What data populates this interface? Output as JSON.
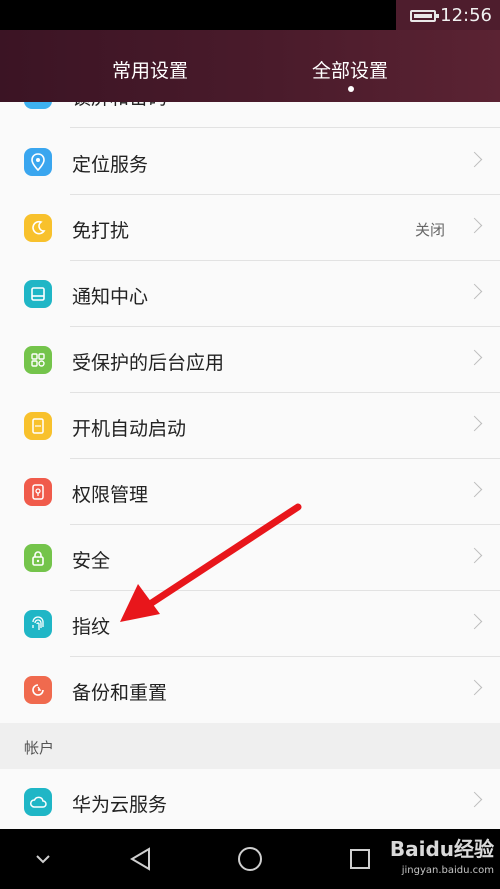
{
  "status_bar": {
    "time": "12:56"
  },
  "tabs": [
    {
      "label": "常用设置"
    },
    {
      "label": "全部设置"
    }
  ],
  "list": {
    "items": [
      {
        "label": "锁屏和密码",
        "icon": "lock-screen-icon",
        "color": "#3db1f0"
      },
      {
        "label": "定位服务",
        "icon": "location-pin-icon",
        "color": "#3aa6ef"
      },
      {
        "label": "免打扰",
        "icon": "moon-icon",
        "color": "#f8c12c",
        "value": "关闭"
      },
      {
        "label": "通知中心",
        "icon": "notification-center-icon",
        "color": "#1fb6c6"
      },
      {
        "label": "受保护的后台应用",
        "icon": "protected-apps-icon",
        "color": "#74c44b"
      },
      {
        "label": "开机自动启动",
        "icon": "auto-start-icon",
        "color": "#f8c12c"
      },
      {
        "label": "权限管理",
        "icon": "permission-manager-icon",
        "color": "#f05b4b"
      },
      {
        "label": "安全",
        "icon": "padlock-icon",
        "color": "#74c44b"
      },
      {
        "label": "指纹",
        "icon": "fingerprint-icon",
        "color": "#1fb6c6"
      },
      {
        "label": "备份和重置",
        "icon": "backup-reset-icon",
        "color": "#f06a4e"
      }
    ],
    "section_header": "帐户",
    "account_items": [
      {
        "label": "华为云服务",
        "icon": "cloud-icon",
        "color": "#1fb6c6"
      }
    ]
  },
  "watermark": {
    "text": "Baidu经验",
    "url": "jingyan.baidu.com"
  }
}
